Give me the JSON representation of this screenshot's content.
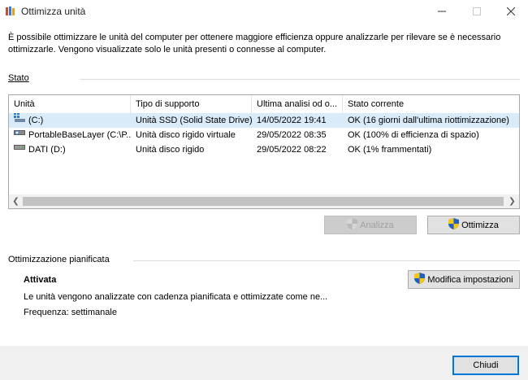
{
  "window": {
    "title": "Ottimizza unità"
  },
  "intro": {
    "text": "È possibile ottimizzare le unità del computer per ottenere maggiore efficienza oppure analizzarle per rilevare se è necessario ottimizzarle. Vengono visualizzate solo le unità presenti o connesse al computer."
  },
  "status_group": {
    "label": "Stato"
  },
  "table": {
    "columns": [
      "Unità",
      "Tipo di supporto",
      "Ultima analisi od o...",
      "Stato corrente"
    ],
    "rows": [
      {
        "drive": "(C:)",
        "type": "Unità SSD (Solid State Drive)",
        "last": "14/05/2022 19:41",
        "status": "OK (16 giorni dall'ultima riottimizzazione)",
        "icon": "windows-drive-icon",
        "selected": true
      },
      {
        "drive": "PortableBaseLayer (C:\\P...",
        "type": "Unità disco rigido virtuale",
        "last": "29/05/2022 08:35",
        "status": "OK (100% di efficienza di spazio)",
        "icon": "virtual-drive-icon",
        "selected": false
      },
      {
        "drive": "DATI (D:)",
        "type": "Unità disco rigido",
        "last": "29/05/2022 08:22",
        "status": "OK (1% frammentati)",
        "icon": "hard-drive-icon",
        "selected": false
      }
    ]
  },
  "buttons": {
    "analyze": "Analizza",
    "optimize": "Ottimizza",
    "change_settings": "Modifica impostazioni",
    "close": "Chiudi"
  },
  "schedule": {
    "title": "Ottimizzazione pianificata",
    "status": "Attivata",
    "description": "Le unità vengono analizzate con cadenza pianificata e ottimizzate come ne...",
    "frequency": "Frequenza: settimanale"
  },
  "colors": {
    "selection": "#d9ebf9",
    "accent": "#0078d7",
    "footer": "#f0f0f0"
  }
}
